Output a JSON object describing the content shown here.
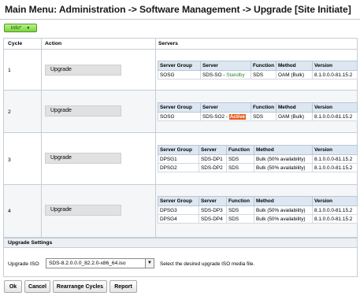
{
  "page": {
    "title": "Main Menu: Administration -> Software Management -> Upgrade [Site Initiate]",
    "info_label": "Info*"
  },
  "table": {
    "headers": {
      "cycle": "Cycle",
      "action": "Action",
      "servers": "Servers"
    },
    "server_headers": {
      "server_group": "Server Group",
      "server": "Server",
      "function": "Function",
      "method": "Method",
      "version": "Version"
    },
    "cycles": [
      {
        "cycle": "1",
        "action": "Upgrade",
        "servers": [
          {
            "group": "SOSG",
            "server": "SDS-SO",
            "status": "Standby",
            "function": "SDS",
            "method": "OAM (Bulk)",
            "version": "8.1.0.0.0-81.15.2"
          }
        ]
      },
      {
        "cycle": "2",
        "action": "Upgrade",
        "servers": [
          {
            "group": "SOSG",
            "server": "SDS-SO2",
            "status": "Active",
            "function": "SDS",
            "method": "OAM (Bulk)",
            "version": "8.1.0.0.0-81.15.2"
          }
        ]
      },
      {
        "cycle": "3",
        "action": "Upgrade",
        "servers": [
          {
            "group": "DPSG1",
            "server": "SDS-DP1",
            "function": "SDS",
            "method": "Bulk (50% availability)",
            "version": "8.1.0.0.0-81.15.2"
          },
          {
            "group": "DPSG2",
            "server": "SDS-DP2",
            "function": "SDS",
            "method": "Bulk (50% availability)",
            "version": "8.1.0.0.0-81.15.2"
          }
        ]
      },
      {
        "cycle": "4",
        "action": "Upgrade",
        "servers": [
          {
            "group": "DPSG3",
            "server": "SDS-DP3",
            "function": "SDS",
            "method": "Bulk (50% availability)",
            "version": "8.1.0.0.0-81.15.2"
          },
          {
            "group": "DPSG4",
            "server": "SDS-DP4",
            "function": "SDS",
            "method": "Bulk (50% availability)",
            "version": "8.1.0.0.0-81.15.2"
          }
        ]
      }
    ]
  },
  "settings": {
    "header": "Upgrade Settings",
    "iso_label": "Upgrade ISO",
    "iso_value": "SDS-8.2.0.0.0_82.2.0-x86_64.iso",
    "iso_help": "Select the desired upgrade ISO media file."
  },
  "buttons": {
    "ok": "Ok",
    "cancel": "Cancel",
    "rearrange": "Rearrange Cycles",
    "report": "Report"
  },
  "colors": {
    "active_badge": "#e85a1b",
    "standby_text": "#2e8a2e",
    "info_button": "#7ad43f"
  }
}
